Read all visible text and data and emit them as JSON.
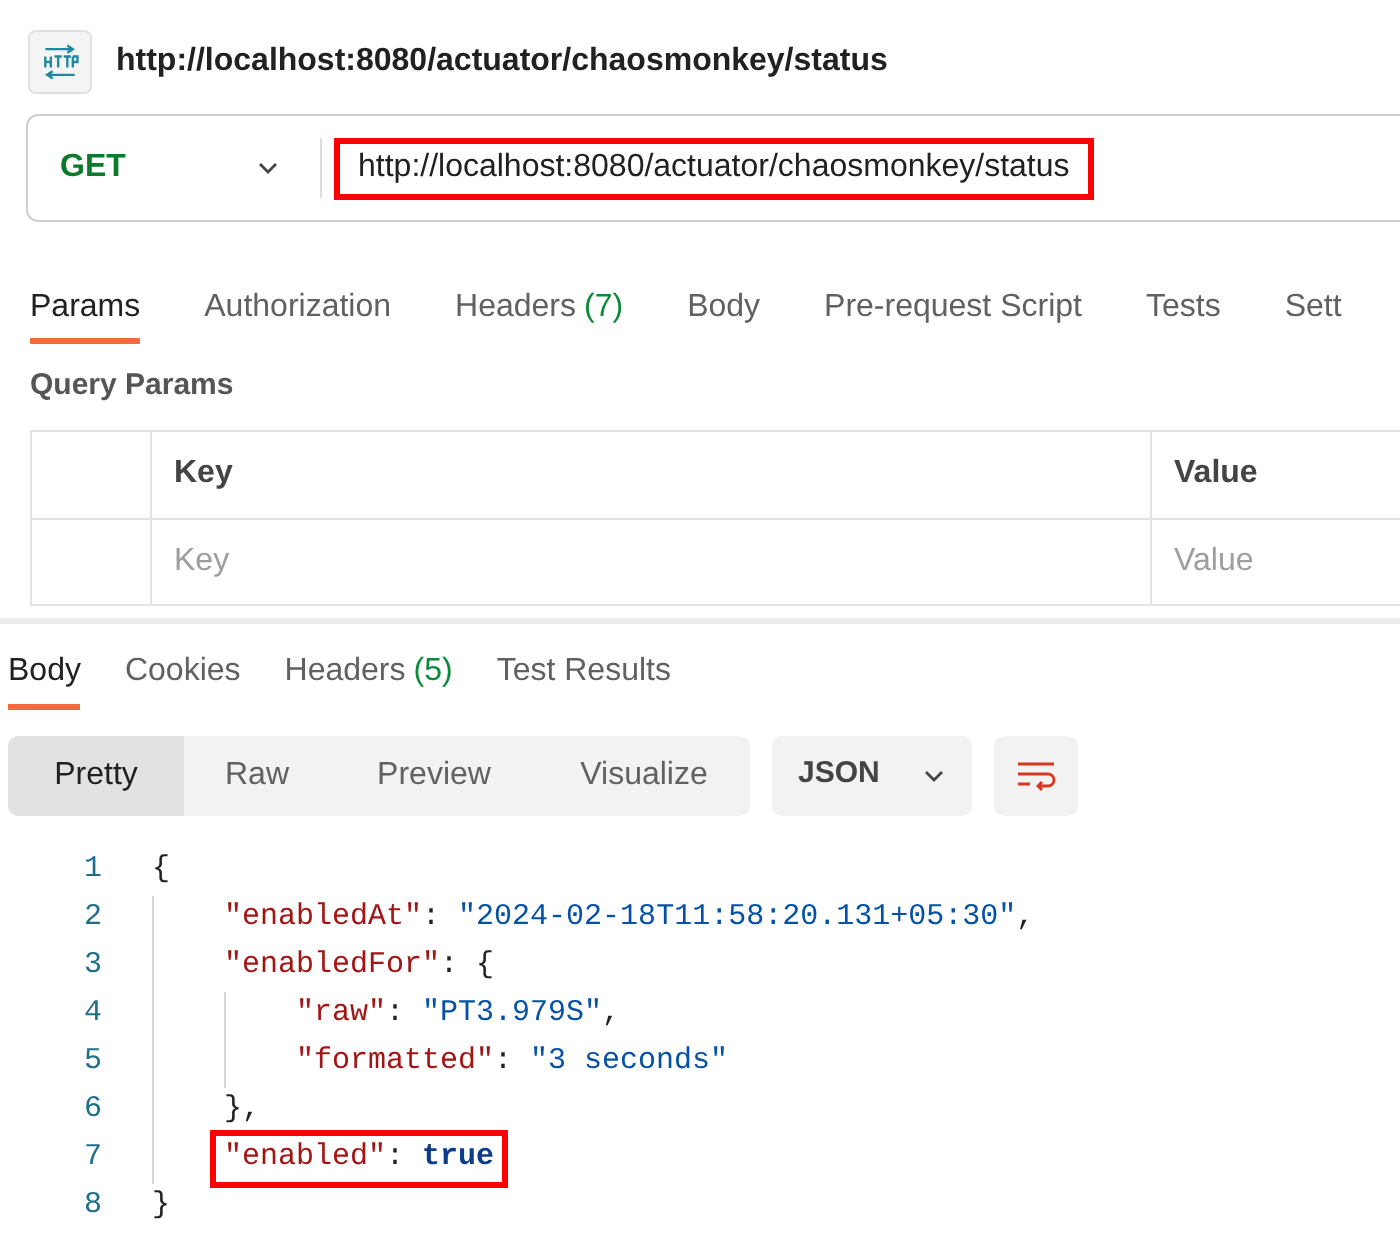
{
  "request": {
    "title": "http://localhost:8080/actuator/chaosmonkey/status",
    "method": "GET",
    "url": "http://localhost:8080/actuator/chaosmonkey/status",
    "url_highlighted": true
  },
  "request_tabs": [
    {
      "label": "Params",
      "selected": true
    },
    {
      "label": "Authorization",
      "selected": false
    },
    {
      "label": "Headers",
      "count": "(7)",
      "selected": false
    },
    {
      "label": "Body",
      "selected": false
    },
    {
      "label": "Pre-request Script",
      "selected": false
    },
    {
      "label": "Tests",
      "selected": false
    },
    {
      "label": "Sett",
      "selected": false
    }
  ],
  "query_params": {
    "title": "Query Params",
    "columns": [
      "Key",
      "Value"
    ],
    "placeholders": [
      "Key",
      "Value"
    ]
  },
  "response_tabs": [
    {
      "label": "Body",
      "selected": true
    },
    {
      "label": "Cookies",
      "selected": false
    },
    {
      "label": "Headers",
      "count": "(5)",
      "selected": false
    },
    {
      "label": "Test Results",
      "selected": false
    }
  ],
  "view_modes": [
    {
      "label": "Pretty",
      "selected": true
    },
    {
      "label": "Raw",
      "selected": false
    },
    {
      "label": "Preview",
      "selected": false
    },
    {
      "label": "Visualize",
      "selected": false
    }
  ],
  "format": "JSON",
  "code_lines": [
    {
      "number": "1",
      "highlighted": false,
      "tokens": [
        {
          "kind": "punct",
          "text": "{"
        }
      ]
    },
    {
      "number": "2",
      "highlighted": false,
      "tokens": [
        {
          "kind": "key",
          "text": "\"enabledAt\""
        },
        {
          "kind": "punct",
          "text": ": "
        },
        {
          "kind": "string",
          "text": "\"2024-02-18T11:58:20.131+05:30\""
        },
        {
          "kind": "punct",
          "text": ","
        }
      ]
    },
    {
      "number": "3",
      "highlighted": false,
      "tokens": [
        {
          "kind": "key",
          "text": "\"enabledFor\""
        },
        {
          "kind": "punct",
          "text": ": {"
        }
      ]
    },
    {
      "number": "4",
      "highlighted": false,
      "tokens": [
        {
          "kind": "key",
          "text": "\"raw\""
        },
        {
          "kind": "punct",
          "text": ": "
        },
        {
          "kind": "string",
          "text": "\"PT3.979S\""
        },
        {
          "kind": "punct",
          "text": ","
        }
      ]
    },
    {
      "number": "5",
      "highlighted": false,
      "tokens": [
        {
          "kind": "key",
          "text": "\"formatted\""
        },
        {
          "kind": "punct",
          "text": ": "
        },
        {
          "kind": "string",
          "text": "\"3 seconds\""
        }
      ]
    },
    {
      "number": "6",
      "highlighted": false,
      "tokens": [
        {
          "kind": "punct",
          "text": "},"
        }
      ]
    },
    {
      "number": "7",
      "highlighted": true,
      "tokens": [
        {
          "kind": "key",
          "text": "\"enabled\""
        },
        {
          "kind": "punct",
          "text": ": "
        },
        {
          "kind": "bool",
          "text": "true"
        }
      ]
    },
    {
      "number": "8",
      "highlighted": false,
      "tokens": [
        {
          "kind": "punct",
          "text": "}"
        }
      ]
    }
  ]
}
